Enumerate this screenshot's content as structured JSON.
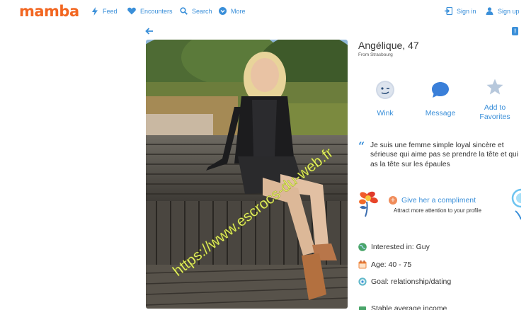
{
  "brand": {
    "logo_text": "mamba",
    "accent": "#f26722",
    "link_color": "#3a8fd9"
  },
  "nav": {
    "feed": "Feed",
    "encounters": "Encounters",
    "search": "Search",
    "more": "More",
    "sign_in": "Sign in",
    "sign_up": "Sign up"
  },
  "profile": {
    "name": "Angélique, 47",
    "from": "From Strasbourg",
    "photo_watermark": "https://www.escrocs-du-web.fr",
    "actions": {
      "wink": "Wink",
      "message": "Message",
      "favorites": "Add to Favorites"
    },
    "about": "Je suis une femme simple loyal sincère et sérieuse qui aime pas se prendre la tête et qui as la tête sur les épaules",
    "compliment": {
      "title": "Give her a compliment",
      "subtitle": "Attract more attention to your profile"
    },
    "details": {
      "interested_in": "Interested in: Guy",
      "age": "Age: 40 - 75",
      "goal": "Goal: relationship/dating",
      "income": "Stable average income"
    }
  },
  "icons": [
    "feed-bolt-icon",
    "heart-icon",
    "search-icon",
    "more-chevron-icon",
    "sign-in-icon",
    "user-icon",
    "back-arrow-icon",
    "report-icon",
    "wink-icon",
    "message-icon",
    "star-icon",
    "quote-icon",
    "flower-icon",
    "plus-icon",
    "globe-icon",
    "calendar-icon",
    "target-icon"
  ]
}
